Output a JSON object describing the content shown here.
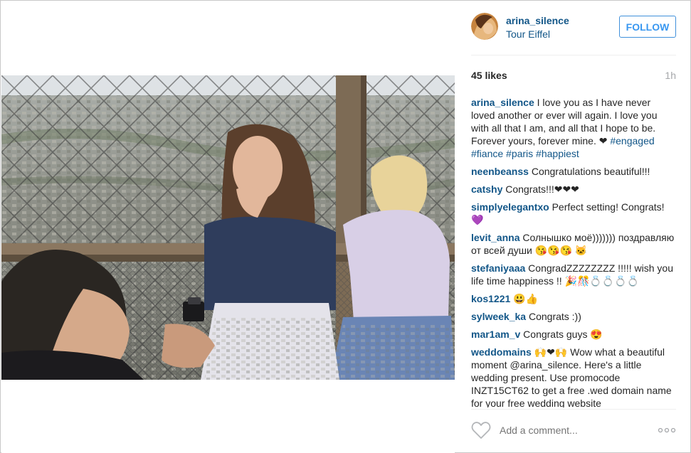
{
  "post": {
    "username": "arina_silence",
    "location": "Tour Eiffel",
    "follow_label": "FOLLOW",
    "likes": "45 likes",
    "age": "1h"
  },
  "comments": [
    {
      "user": "arina_silence",
      "text": "I love you as I have never loved another or ever will again. I love you with all that I am, and all that I hope to be. Forever yours, forever mine. ❤",
      "tags": "#engaged #fiance #paris #happiest"
    },
    {
      "user": "neenbeanss",
      "text": "Congratulations beautiful!!!"
    },
    {
      "user": "catshy",
      "text": "Congrats!!!❤❤❤"
    },
    {
      "user": "simplyelegantxo",
      "text": "Perfect setting! Congrats! 💜"
    },
    {
      "user": "levit_anna",
      "text": "Солнышко моё))))))) поздравляю от всей души 😘😘😘 🐱"
    },
    {
      "user": "stefaniyaaa",
      "text": "CongradZZZZZZZZ !!!!! wish you life time happiness !! 🎉🎊💍💍💍💍"
    },
    {
      "user": "kos1221",
      "text": "😃👍"
    },
    {
      "user": "sylweek_ka",
      "text": "Congrats :))"
    },
    {
      "user": "mar1am_v",
      "text": "Congrats guys 😍"
    },
    {
      "user": "weddomains",
      "text": "🙌❤🙌 Wow what a beautiful moment @arina_silence. Here's a little wedding present. Use promocode INZT15CT62 to get a free .wed domain name for your free wedding website"
    }
  ],
  "footer": {
    "add_comment_placeholder": "Add a comment...",
    "icon_like": "heart-outline-icon",
    "icon_more": "more-options-icon"
  },
  "colors": {
    "link": "#125688",
    "follow": "#3897f0",
    "muted": "#a5a7aa"
  }
}
